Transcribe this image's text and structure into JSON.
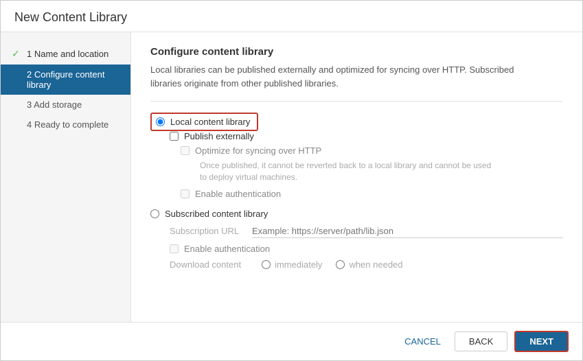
{
  "dialog": {
    "title": "New Content Library"
  },
  "sidebar": {
    "items": [
      {
        "id": "step1",
        "label": "1 Name and location",
        "state": "completed"
      },
      {
        "id": "step2",
        "label": "2 Configure content library",
        "state": "active"
      },
      {
        "id": "step3",
        "label": "3 Add storage",
        "state": "upcoming"
      },
      {
        "id": "step4",
        "label": "4 Ready to complete",
        "state": "upcoming"
      }
    ]
  },
  "main": {
    "section_title": "Configure content library",
    "section_desc1": "Local libraries can be published externally and optimized for syncing over HTTP. Subscribed",
    "section_desc2": "libraries originate from other published libraries.",
    "local_library_label": "Local content library",
    "publish_externally_label": "Publish externally",
    "optimize_label": "Optimize for syncing over HTTP",
    "optimize_note1": "Once published, it cannot be reverted back to a local library and cannot be used",
    "optimize_note2": "to deploy virtual machines.",
    "enable_auth_local_label": "Enable authentication",
    "subscribed_label": "Subscribed content library",
    "subscription_url_label": "Subscription URL",
    "subscription_url_placeholder": "Example: https://server/path/lib.json",
    "enable_auth_sub_label": "Enable authentication",
    "download_content_label": "Download content",
    "immediately_label": "immediately",
    "when_needed_label": "when needed"
  },
  "footer": {
    "cancel_label": "CANCEL",
    "back_label": "BACK",
    "next_label": "NEXT"
  }
}
